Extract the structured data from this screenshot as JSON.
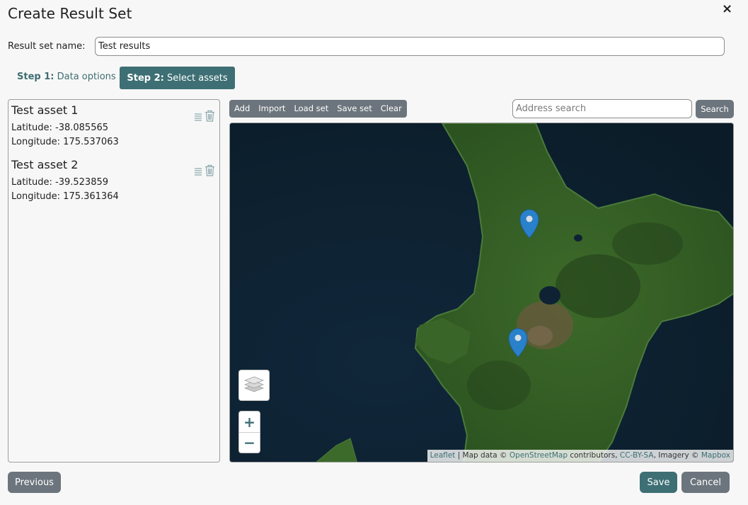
{
  "dialog": {
    "title": "Create Result Set",
    "close_icon": "×"
  },
  "name_field": {
    "label": "Result set name:",
    "value": "Test results"
  },
  "steps": [
    {
      "prefix": "Step 1:",
      "label": "Data options",
      "active": false
    },
    {
      "prefix": "Step 2:",
      "label": "Select assets",
      "active": true
    }
  ],
  "assets": [
    {
      "name": "Test asset 1",
      "latitude": "Latitude: -38.085565",
      "longitude": "Longitude: 175.537063"
    },
    {
      "name": "Test asset 2",
      "latitude": "Latitude: -39.523859",
      "longitude": "Longitude: 175.361364"
    }
  ],
  "toolbar": [
    "Add",
    "Import",
    "Load set",
    "Save set",
    "Clear"
  ],
  "address_search": {
    "placeholder": "Address search",
    "button": "Search"
  },
  "map": {
    "zoom_in": "+",
    "zoom_out": "−",
    "layers_icon": "layers-icon",
    "marker_color": "#2a81cb",
    "attribution": {
      "leaflet": "Leaflet",
      "text1": " | Map data © ",
      "osm": "OpenStreetMap",
      "text2": " contributors, ",
      "license": "CC-BY-SA",
      "text3": ", Imagery © ",
      "mapbox": "Mapbox"
    }
  },
  "footer": {
    "previous": "Previous",
    "save": "Save",
    "cancel": "Cancel"
  },
  "colors": {
    "primary": "#3d6f74",
    "secondary": "#6c757d"
  }
}
